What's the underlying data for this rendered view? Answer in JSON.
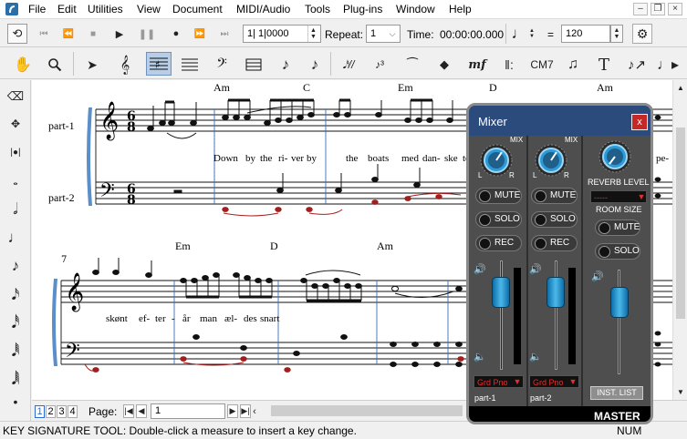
{
  "menubar": {
    "items": [
      "File",
      "Edit",
      "Utilities",
      "View",
      "Document",
      "MIDI/Audio",
      "Tools",
      "Plug-ins",
      "Window",
      "Help"
    ]
  },
  "transport": {
    "position": "1| 1|0000",
    "repeat_label": "Repeat:",
    "repeat_value": "1",
    "time_label": "Time:",
    "time_value": "00:00:00.000",
    "equals": "=",
    "tempo": "120"
  },
  "tools": {
    "chord_tool_label": "CM7",
    "text_tool_label": "T",
    "dynamics_label": "mf"
  },
  "score": {
    "system1": {
      "parts": [
        "part-1",
        "part-2"
      ],
      "chords": [
        "Am",
        "C",
        "Em",
        "D",
        "Am"
      ],
      "lyrics": [
        "Down",
        "by",
        "the",
        "ri-",
        "ver",
        "by",
        "the",
        "boats",
        "med",
        "dan-",
        "ske",
        "te-",
        "pe-"
      ],
      "time_signature_top": "6",
      "time_signature_bottom": "8"
    },
    "system2": {
      "measure_number": "7",
      "chords": [
        "Em",
        "D",
        "Am"
      ],
      "lyrics": [
        "skønt",
        "ef-",
        "ter",
        "-",
        "år",
        "man",
        "æl-",
        "des",
        "snart"
      ]
    }
  },
  "bottombar": {
    "page_tabs": [
      "1",
      "2",
      "3",
      "4"
    ],
    "active_tab": "1",
    "page_label": "Page:",
    "page_value": "1"
  },
  "status": {
    "message": "KEY SIGNATURE TOOL: Double-click a measure to insert a key change.",
    "num_indicator": "NUM"
  },
  "mixer": {
    "title": "Mixer",
    "close": "x",
    "mix_label": "MIX",
    "l_label": "L",
    "r_label": "R",
    "channels": [
      {
        "name": "part-1",
        "instrument": "Grd Pno",
        "mute": "MUTE",
        "solo": "SOLO",
        "rec": "REC"
      },
      {
        "name": "part-2",
        "instrument": "Grd Pno",
        "mute": "MUTE",
        "solo": "SOLO",
        "rec": "REC"
      }
    ],
    "master": {
      "reverb_label": "REVERB LEVEL",
      "reverb_value": "-----",
      "room_size_label": "ROOM SIZE",
      "mute": "MUTE",
      "solo": "SOLO",
      "inst_list": "INST. LIST",
      "name": "MASTER"
    },
    "accent": "#2a4b7c",
    "knob_color": "#2a9bd8"
  }
}
